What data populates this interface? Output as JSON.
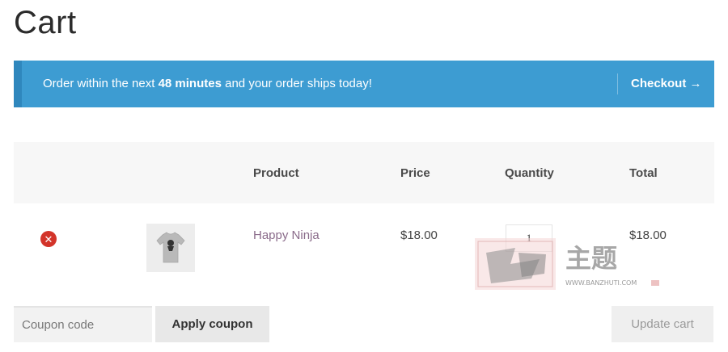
{
  "page": {
    "title": "Cart"
  },
  "notice": {
    "text_before": "Order within the next ",
    "text_bold": "48 minutes",
    "text_after": " and your order ships today!",
    "checkout_label": "Checkout →"
  },
  "table": {
    "headers": [
      "Product",
      "Price",
      "Quantity",
      "Total"
    ],
    "rows": [
      {
        "product": "Happy Ninja",
        "price": "$18.00",
        "quantity": "1",
        "total": "$18.00",
        "remove_icon": "close-icon"
      }
    ]
  },
  "actions": {
    "coupon_placeholder": "Coupon code",
    "apply_label": "Apply coupon",
    "update_label": "Update cart"
  },
  "watermark": {
    "text": "主题",
    "url": "WWW.BANZHUTI.COM"
  },
  "colors": {
    "notice_bg": "#3d9cd2",
    "remove_red": "#d3342a",
    "product_link": "#8a6b8a"
  }
}
